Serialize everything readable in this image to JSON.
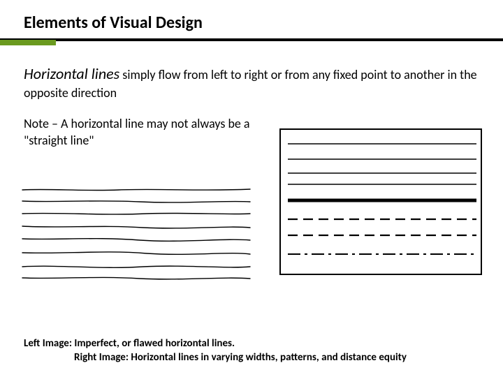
{
  "title": "Elements of Visual Design",
  "definition": {
    "lead": "Horizontal lines",
    "rest": " simply flow from left to right  or from any fixed point to another in the opposite direction"
  },
  "note": "Note – A horizontal line may not always be a \"straight line\"",
  "captions": {
    "left": "Left Image: Imperfect, or flawed horizontal lines.",
    "right": "Right Image: Horizontal lines in varying widths, patterns, and distance equity"
  }
}
